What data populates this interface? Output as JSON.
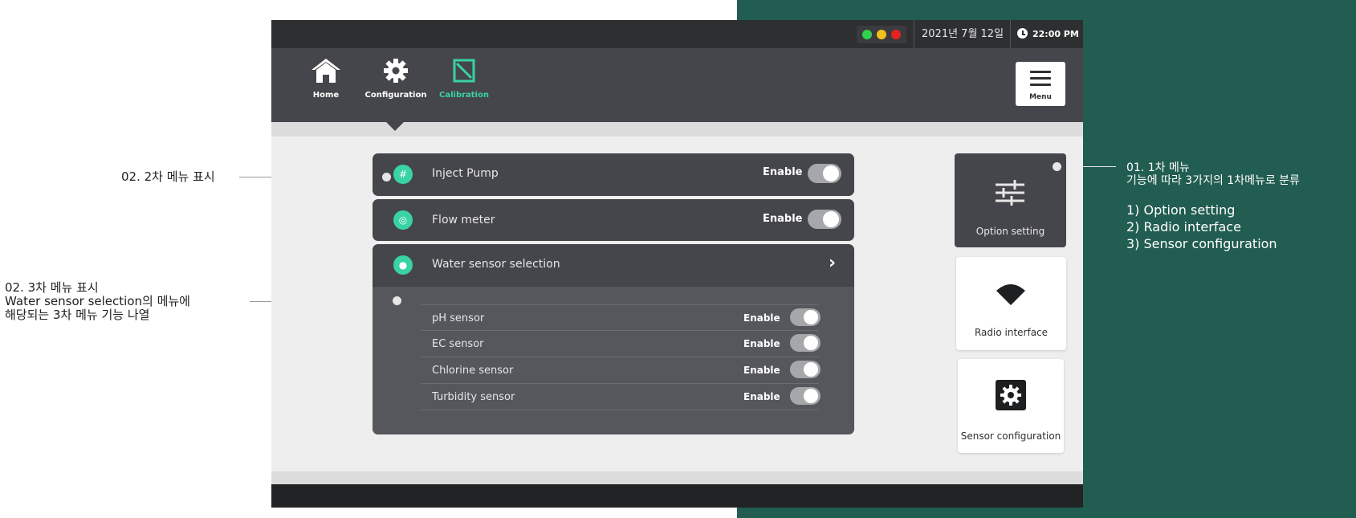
{
  "status": {
    "lights": [
      "#2fd14d",
      "#f1c21b",
      "#e52222"
    ],
    "date": "2021년 7월 12일",
    "time": "22:00 PM"
  },
  "nav": {
    "home": "Home",
    "configuration": "Configuration",
    "calibration": "Calibration",
    "menu": "Menu"
  },
  "list": {
    "inject_pump": {
      "label": "Inject Pump",
      "state": "Enable"
    },
    "flow_meter": {
      "label": "Flow meter",
      "state": "Enable"
    },
    "water_sensor": {
      "label": "Water sensor selection"
    },
    "sensors": [
      {
        "label": "pH sensor",
        "state": "Enable"
      },
      {
        "label": "EC sensor",
        "state": "Enable"
      },
      {
        "label": "Chlorine sensor",
        "state": "Enable"
      },
      {
        "label": "Turbidity sensor",
        "state": "Enable"
      }
    ]
  },
  "cards": {
    "option": "Option setting",
    "radio": "Radio interface",
    "sensor": "Sensor configuration"
  },
  "annotations": {
    "left1": "02. 2차 메뉴 표시",
    "left2_l1": "02. 3차 메뉴 표시",
    "left2_l2": "Water sensor selection의 메뉴에",
    "left2_l3": "해당되는 3차 메뉴 기능 나열",
    "right_title": "01. 1차 메뉴",
    "right_sub": "기능에 따라 3가지의 1차메뉴로 분류",
    "right_items": [
      "1) Option setting",
      "2) Radio interface",
      "3) Sensor configuration"
    ]
  },
  "colors": {
    "accent": "#39d3a4",
    "panel": "#45464b",
    "annotation_bg": "#225d52"
  }
}
